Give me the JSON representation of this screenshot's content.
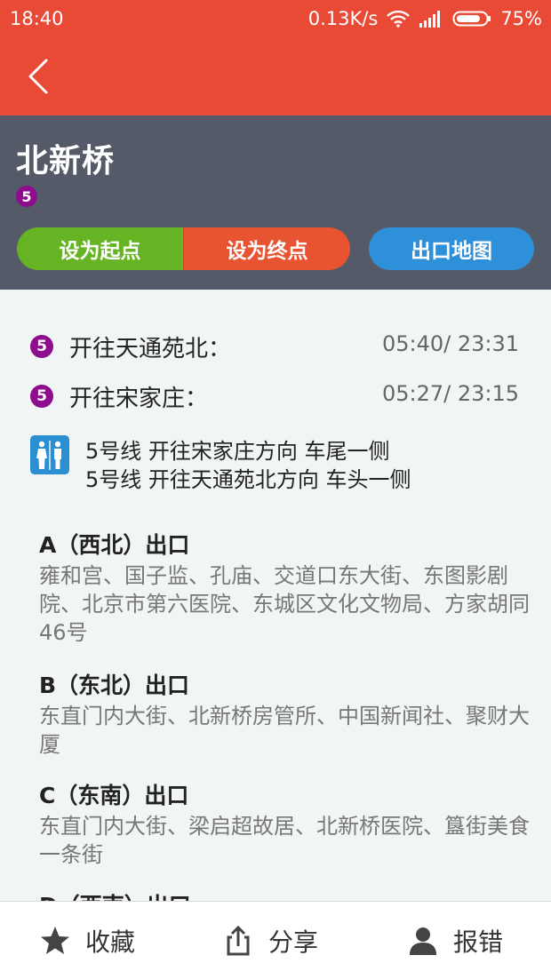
{
  "status_bar": {
    "time": "18:40",
    "network_speed": "0.13K/s",
    "battery": "75%"
  },
  "header": {
    "station_name": "北新桥",
    "line_number": "5",
    "line_color": "#8e0d8e",
    "buttons": {
      "set_start": "设为起点",
      "set_end": "设为终点",
      "exit_map": "出口地图"
    }
  },
  "directions": [
    {
      "line": "5",
      "label": "开往天通苑北：",
      "time": "05:40/ 23:31"
    },
    {
      "line": "5",
      "label": "开往宋家庄：",
      "time": "05:27/ 23:15"
    }
  ],
  "toilet": {
    "icon": "restroom-icon",
    "lines": [
      "5号线 开往宋家庄方向 车尾一侧",
      "5号线 开往天通苑北方向 车头一侧"
    ]
  },
  "exits": [
    {
      "title": "A（西北）出口",
      "desc": "雍和宫、国子监、孔庙、交道口东大街、东图影剧院、北京市第六医院、东城区文化文物局、方家胡同46号"
    },
    {
      "title": "B（东北）出口",
      "desc": "东直门内大街、北新桥房管所、中国新闻社、聚财大厦"
    },
    {
      "title": "C（东南）出口",
      "desc": "东直门内大街、梁启超故居、北新桥医院、簋街美食一条街"
    },
    {
      "title": "D（西南）出口",
      "desc": ""
    }
  ],
  "bottom_bar": {
    "favorite": "收藏",
    "share": "分享",
    "report": "报错"
  },
  "colors": {
    "topbar": "#e84a36",
    "header_bg": "#545a67",
    "start_button": "#66b323",
    "end_button": "#e85431",
    "exit_map_button": "#2e90d9"
  }
}
